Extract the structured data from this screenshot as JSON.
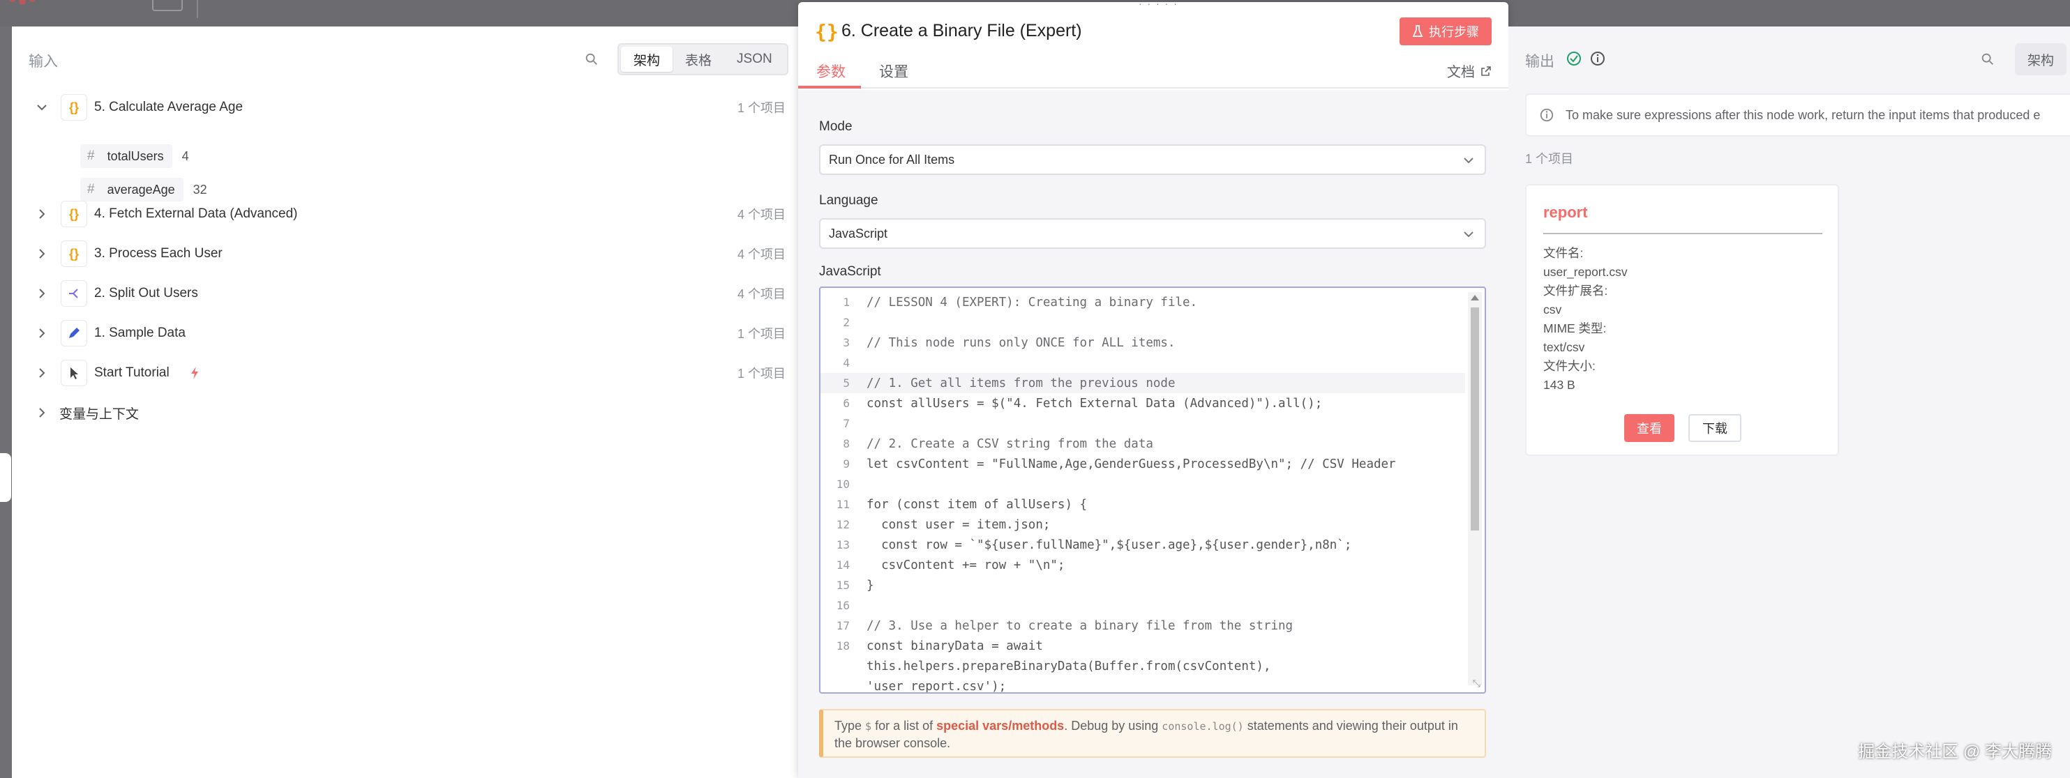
{
  "input_panel": {
    "title": "输入",
    "view_modes": [
      "架构",
      "表格",
      "JSON"
    ],
    "active_view": "架构",
    "nodes": [
      {
        "label": "5. Calculate Average Age",
        "count": "1 个项目",
        "icon": "braces-icon",
        "expanded": true
      },
      {
        "label": "4. Fetch External Data (Advanced)",
        "count": "4 个项目",
        "icon": "braces-icon",
        "expanded": false
      },
      {
        "label": "3. Process Each User",
        "count": "4 个项目",
        "icon": "braces-icon",
        "expanded": false
      },
      {
        "label": "2. Split Out Users",
        "count": "4 个项目",
        "icon": "split-icon",
        "expanded": false
      },
      {
        "label": "1. Sample Data",
        "count": "1 个项目",
        "icon": "pencil-icon",
        "expanded": false
      },
      {
        "label": "Start Tutorial",
        "count": "1 个项目",
        "icon": "cursor-icon",
        "expanded": false
      }
    ],
    "fields": [
      {
        "name": "totalUsers",
        "value": "4"
      },
      {
        "name": "averageAge",
        "value": "32"
      }
    ],
    "variables_label": "变量与上下文"
  },
  "modal": {
    "title_icon": "{}",
    "title": "6. Create a Binary File (Expert)",
    "execute_label": "执行步骤",
    "tabs": [
      "参数",
      "设置"
    ],
    "active_tab": "参数",
    "docs_label": "文档",
    "mode_label": "Mode",
    "mode_value": "Run Once for All Items",
    "language_label": "Language",
    "language_value": "JavaScript",
    "code_label": "JavaScript",
    "hint": {
      "prefix": "Type ",
      "dollar": "$",
      "mid": " for a list of ",
      "link": "special vars/methods",
      "after": ". Debug by using ",
      "code": "console.log()",
      "suffix": " statements and viewing their output in the browser console."
    }
  },
  "code_lines": [
    {
      "n": "1",
      "text": "// LESSON 4 (EXPERT): Creating a binary file."
    },
    {
      "n": "2",
      "text": ""
    },
    {
      "n": "3",
      "text": "// This node runs only ONCE for ALL items."
    },
    {
      "n": "4",
      "text": ""
    },
    {
      "n": "5",
      "text": "// 1. Get all items from the previous node"
    },
    {
      "n": "6",
      "text": "const allUsers = $(\"4. Fetch External Data (Advanced)\").all();"
    },
    {
      "n": "7",
      "text": ""
    },
    {
      "n": "8",
      "text": "// 2. Create a CSV string from the data"
    },
    {
      "n": "9",
      "text": "let csvContent = \"FullName,Age,GenderGuess,ProcessedBy\\n\"; // CSV Header"
    },
    {
      "n": "10",
      "text": ""
    },
    {
      "n": "11",
      "text": "for (const item of allUsers) {"
    },
    {
      "n": "12",
      "text": "  const user = item.json;"
    },
    {
      "n": "13",
      "text": "  const row = `\"${user.fullName}\",${user.age},${user.gender},n8n`;"
    },
    {
      "n": "14",
      "text": "  csvContent += row + \"\\n\";"
    },
    {
      "n": "15",
      "text": "}"
    },
    {
      "n": "16",
      "text": ""
    },
    {
      "n": "17",
      "text": "// 3. Use a helper to create a binary file from the string"
    },
    {
      "n": "18",
      "text": "const binaryData = await"
    },
    {
      "n": "",
      "text": "this.helpers.prepareBinaryData(Buffer.from(csvContent),"
    },
    {
      "n": "",
      "text": "'user_report.csv');"
    }
  ],
  "output_panel": {
    "title": "输出",
    "view_mode": "架构",
    "notice": "To make sure expressions after this node work, return the input items that produced e",
    "count": "1 个项目",
    "binary": {
      "name": "report",
      "file_name_label": "文件名:",
      "file_name": "user_report.csv",
      "ext_label": "文件扩展名:",
      "ext": "csv",
      "mime_label": "MIME 类型:",
      "mime": "text/csv",
      "size_label": "文件大小:",
      "size": "143 B",
      "view_label": "查看",
      "download_label": "下载"
    }
  },
  "watermark": "掘金技术社区 @ 李大腾腾",
  "colors": {
    "accent": "#f56c6c",
    "success": "#22a06b",
    "braces": "#f59e0b"
  }
}
